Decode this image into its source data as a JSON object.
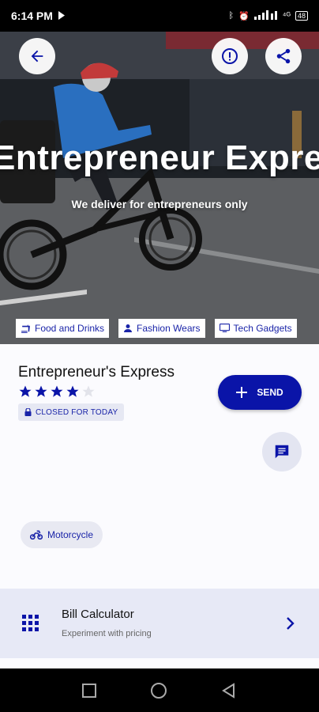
{
  "status_bar": {
    "time": "6:14 PM",
    "battery": "48"
  },
  "hero": {
    "title": "Entrepreneur Express",
    "subtitle": "We deliver for entrepreneurs only"
  },
  "categories": [
    {
      "label": "Food and Drinks",
      "icon": "food-icon"
    },
    {
      "label": "Fashion Wears",
      "icon": "person-icon"
    },
    {
      "label": "Tech Gadgets",
      "icon": "monitor-icon"
    }
  ],
  "shop": {
    "name": "Entrepreneur's Express",
    "rating": 4,
    "rating_max": 5,
    "status": "CLOSED FOR TODAY"
  },
  "actions": {
    "send_label": "SEND"
  },
  "vehicle": {
    "label": "Motorcycle"
  },
  "bill_calculator": {
    "title": "Bill Calculator",
    "subtitle": "Experiment with pricing"
  },
  "colors": {
    "accent": "#0a14a8",
    "panel": "#fbfbfe",
    "card": "#e7e9f6"
  }
}
